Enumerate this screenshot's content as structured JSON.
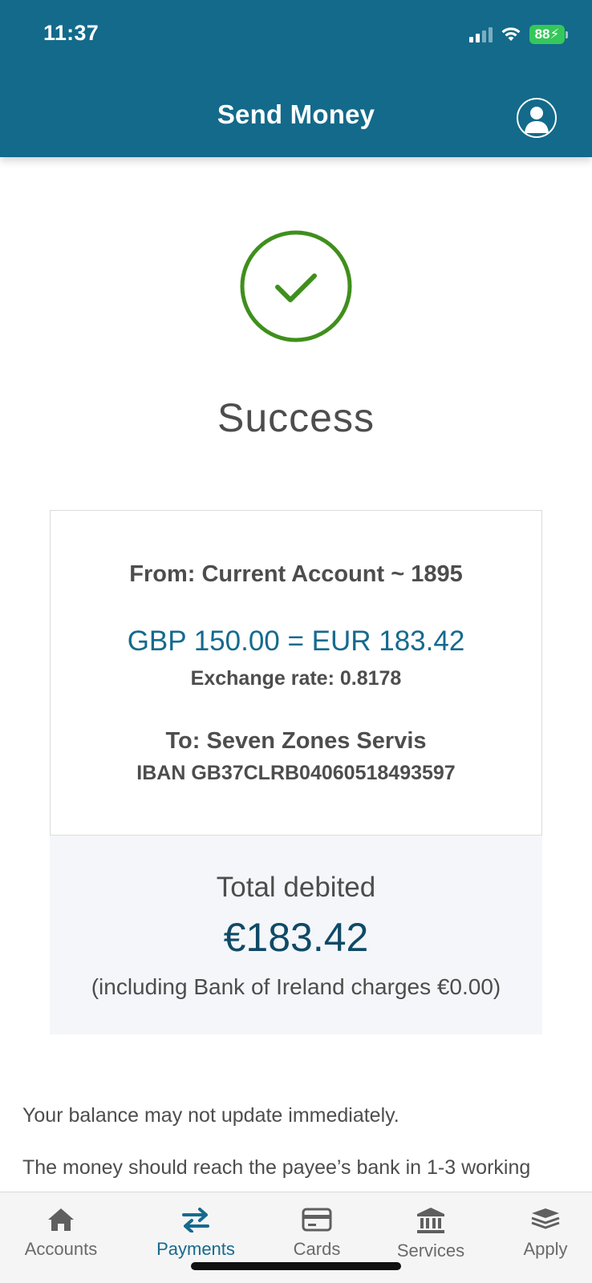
{
  "status_bar": {
    "time": "11:37",
    "battery": "88"
  },
  "header": {
    "title": "Send Money"
  },
  "result": {
    "title": "Success"
  },
  "transfer": {
    "from": "From: Current Account ~ 1895",
    "conversion": "GBP 150.00 = EUR 183.42",
    "exchange_rate": "Exchange rate: 0.8178",
    "to": "To: Seven Zones Servis",
    "iban": "IBAN GB37CLRB04060518493597"
  },
  "total": {
    "label": "Total debited",
    "amount": "€183.42",
    "charges": "(including Bank of Ireland charges €0.00)"
  },
  "notes": {
    "balance": "Your balance may not update immediately.",
    "arrival": "The money should reach the payee’s bank in 1-3 working"
  },
  "tabs": [
    {
      "label": "Accounts",
      "icon": "home-icon"
    },
    {
      "label": "Payments",
      "icon": "transfer-arrows-icon"
    },
    {
      "label": "Cards",
      "icon": "card-icon"
    },
    {
      "label": "Services",
      "icon": "bank-icon"
    },
    {
      "label": "Apply",
      "icon": "layers-icon"
    }
  ],
  "colors": {
    "header": "#136a8a",
    "success": "#3f8f1c",
    "accent": "#166a8e",
    "battery": "#35c759"
  }
}
